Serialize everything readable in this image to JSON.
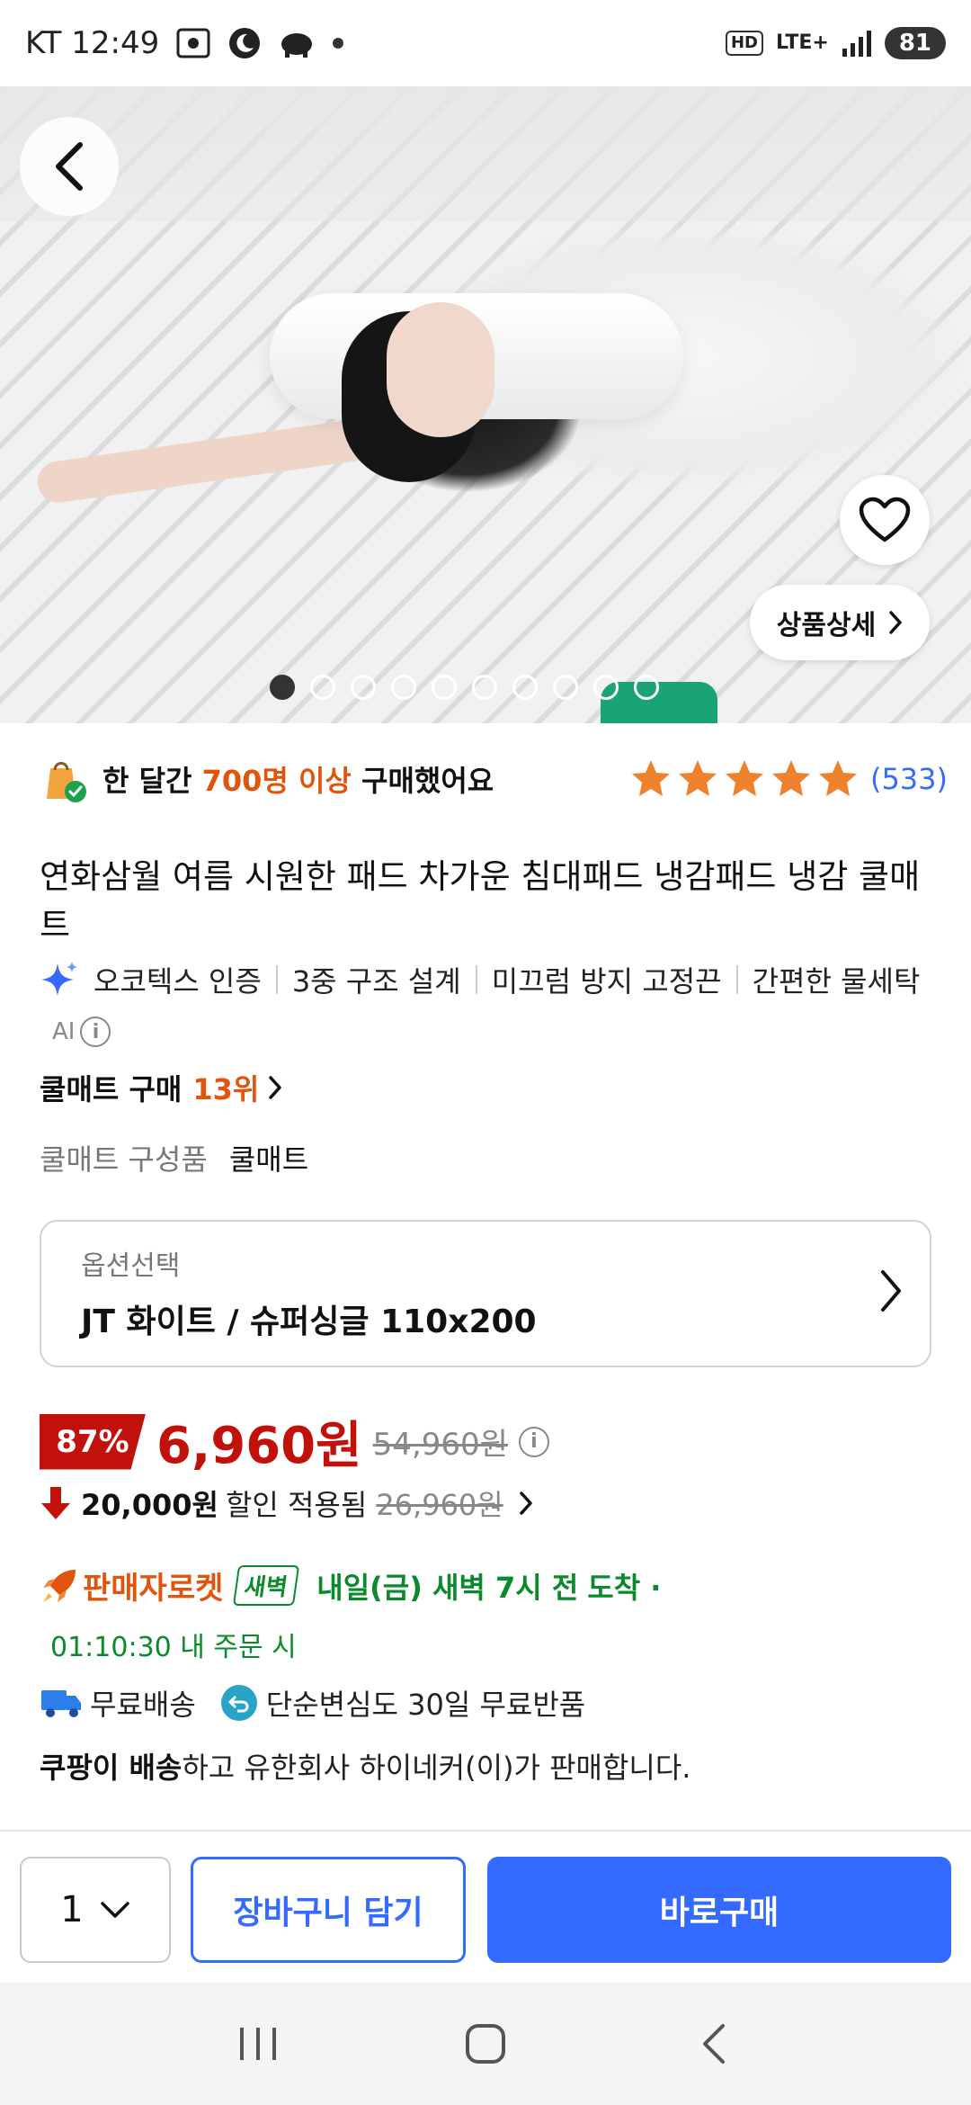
{
  "status_bar": {
    "carrier_time": "KT 12:49",
    "hd": "HD",
    "network": "LTE+",
    "battery": "81"
  },
  "hero": {
    "detail_button": "상품상세",
    "page_count": 10,
    "current_page": 1
  },
  "social": {
    "prefix": "한 달간 ",
    "highlight": "700명 이상",
    "suffix": " 구매했어요",
    "rating": 5,
    "review_count": "(533)"
  },
  "product": {
    "title": "연화삼월 여름 시원한 패드 차가운 침대패드 냉감패드 냉감 쿨매트",
    "features": [
      "오코텍스 인증",
      "3중 구조 설계",
      "미끄럼 방지 고정끈",
      "간편한 물세탁"
    ],
    "ai_label": "AI"
  },
  "ranking": {
    "label": "쿨매트 구매",
    "rank": "13위"
  },
  "composition": {
    "label": "쿨매트 구성품",
    "value": "쿨매트"
  },
  "option": {
    "label": "옵션선택",
    "value": "JT 화이트 / 슈퍼싱글 110x200"
  },
  "price": {
    "discount": "87%",
    "sale": "6,960원",
    "original": "54,960원",
    "coupon_amount": "20,000원",
    "coupon_text": "할인 적용됨",
    "coupon_original": "26,960원"
  },
  "delivery": {
    "seller_rocket": "판매자로켓",
    "badge": "새벽",
    "eta": "내일(금) 새벽 7시 전",
    "suffix": "도착 ·",
    "countdown": "01:10:30 내 주문 시",
    "free_shipping": "무료배송",
    "free_return": "단순변심도 30일 무료반품",
    "seller_bold": "쿠팡이 배송",
    "seller_rest": "하고 유한회사 하이네커(이)가 판매합니다."
  },
  "actions": {
    "quantity": "1",
    "cart": "장바구니 담기",
    "buy_now": "바로구매"
  },
  "colors": {
    "accent_blue": "#346aff",
    "price_red": "#c2110b",
    "orange": "#e0540b",
    "green": "#0a8a2a"
  }
}
